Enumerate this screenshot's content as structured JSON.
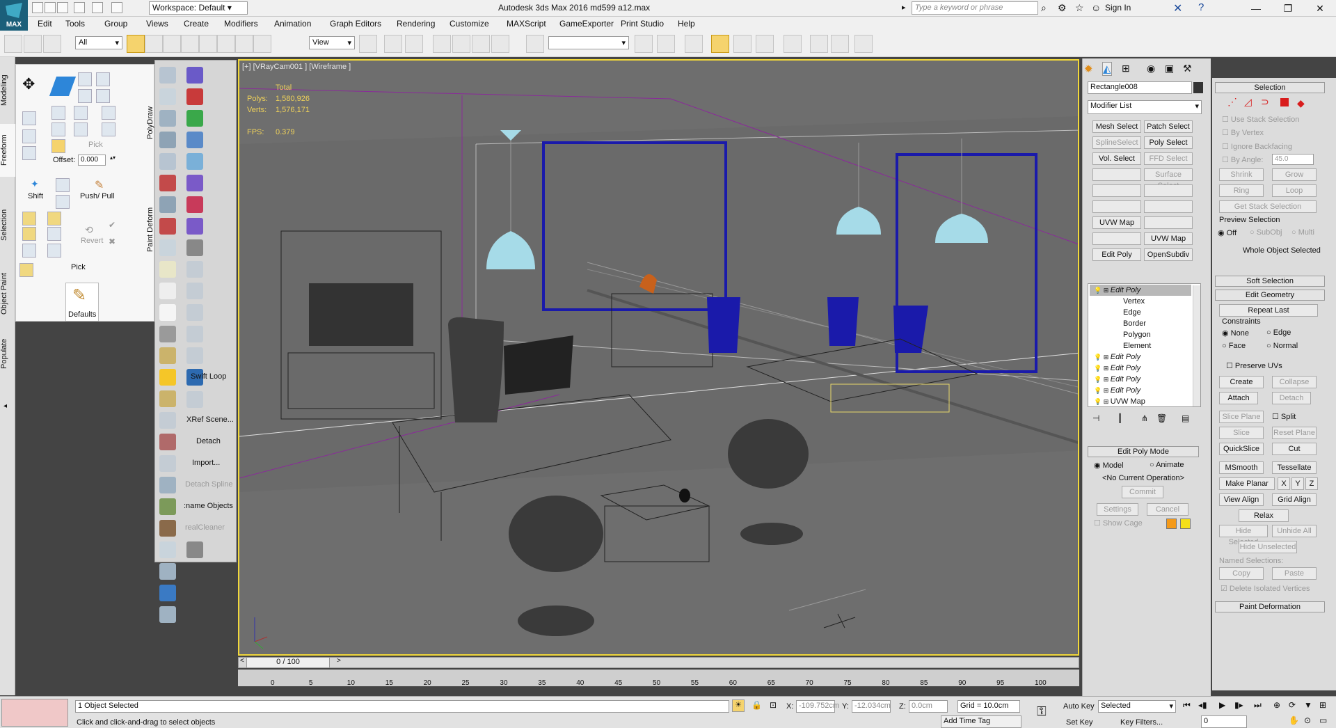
{
  "app": {
    "title": "Autodesk 3ds Max 2016     md599 a12.max",
    "logo_text": "MAX",
    "workspace": "Workspace: Default",
    "search_placeholder": "Type a keyword or phrase",
    "sign_in": "Sign In"
  },
  "menu": [
    "Edit",
    "Tools",
    "Group",
    "Views",
    "Create",
    "Modifiers",
    "Animation",
    "Graph Editors",
    "Rendering",
    "Customize",
    "MAXScript",
    "GameExporter",
    "Print Studio",
    "Help"
  ],
  "toolbar": {
    "selection_filter": "All",
    "ref_coord": "View"
  },
  "ribbon": {
    "tabs": [
      "Modeling",
      "Freeform",
      "Selection",
      "Object Paint",
      "Populate"
    ],
    "polydraw_label": "PolyDraw",
    "paint_deform_label": "Paint Deform",
    "pick_label": "Pick",
    "offset_label": "Offset:",
    "offset_value": "0.000",
    "shift_label": "Shift",
    "push_pull_label": "Push/ Pull",
    "revert_label": "Revert",
    "pick2_label": "Pick",
    "defaults_label": "Defaults"
  },
  "script_buttons": {
    "swift_loop": "Swift Loop",
    "xref_scene": "XRef Scene...",
    "detach": "Detach",
    "import": "Import...",
    "detach_spline": "Detach Spline",
    "name_objects": ":name Objects",
    "real_cleaner": "realCleaner"
  },
  "viewport": {
    "label": "[+] [VRayCam001 ] [Wireframe ]",
    "stats_header": "Total",
    "polys_label": "Polys:",
    "polys_value": "1,580,926",
    "verts_label": "Verts:",
    "verts_value": "1,576,171",
    "fps_label": "FPS:",
    "fps_value": "0.379"
  },
  "command_panel": {
    "object_name": "Rectangle008",
    "modifier_list": "Modifier List",
    "modifier_buttons": [
      [
        "Mesh Select",
        "Patch Select"
      ],
      [
        "SplineSelect",
        "Poly Select"
      ],
      [
        "Vol. Select",
        "FFD Select"
      ],
      [
        "",
        "Surface Select"
      ],
      [
        "",
        ""
      ],
      [
        "",
        ""
      ],
      [
        "UVW Map",
        ""
      ],
      [
        "",
        "UVW Map"
      ],
      [
        "Edit Poly",
        "OpenSubdiv"
      ]
    ],
    "stack": [
      {
        "name": "Edit Poly",
        "level": 0,
        "selected": true
      },
      {
        "name": "Vertex",
        "level": 1
      },
      {
        "name": "Edge",
        "level": 1
      },
      {
        "name": "Border",
        "level": 1
      },
      {
        "name": "Polygon",
        "level": 1
      },
      {
        "name": "Element",
        "level": 1
      },
      {
        "name": "Edit Poly",
        "level": 0
      },
      {
        "name": "Edit Poly",
        "level": 0
      },
      {
        "name": "Edit Poly",
        "level": 0
      },
      {
        "name": "Edit Poly",
        "level": 0
      },
      {
        "name": "UVW Map",
        "level": 0
      }
    ],
    "edit_poly_mode": "Edit Poly Mode",
    "model_label": "Model",
    "animate_label": "Animate",
    "no_operation": "<No Current Operation>",
    "commit": "Commit",
    "settings": "Settings",
    "cancel": "Cancel",
    "show_cage": "Show Cage"
  },
  "selection_rollout": {
    "title": "Selection",
    "use_stack": "Use Stack Selection",
    "by_vertex": "By Vertex",
    "ignore_backfacing": "Ignore Backfacing",
    "by_angle": "By Angle:",
    "by_angle_value": "45.0",
    "shrink": "Shrink",
    "grow": "Grow",
    "ring": "Ring",
    "loop": "Loop",
    "get_stack": "Get Stack Selection",
    "preview_selection": "Preview Selection",
    "off": "Off",
    "subobj": "SubObj",
    "multi": "Multi",
    "whole_object": "Whole Object Selected",
    "soft_selection": "Soft Selection",
    "edit_geometry": "Edit Geometry",
    "repeat_last": "Repeat Last",
    "constraints": "Constraints",
    "none": "None",
    "edge": "Edge",
    "face": "Face",
    "normal": "Normal",
    "preserve_uvs": "Preserve UVs",
    "create": "Create",
    "collapse": "Collapse",
    "attach": "Attach",
    "detach": "Detach",
    "slice_plane": "Slice Plane",
    "split": "Split",
    "slice": "Slice",
    "reset_plane": "Reset Plane",
    "quickslice": "QuickSlice",
    "cut": "Cut",
    "msmooth": "MSmooth",
    "tessellate": "Tessellate",
    "make_planar": "Make Planar",
    "x": "X",
    "y": "Y",
    "z": "Z",
    "view_align": "View Align",
    "grid_align": "Grid Align",
    "relax": "Relax",
    "hide_selected": "Hide Selected",
    "unhide_all": "Unhide All",
    "hide_unselected": "Hide Unselected",
    "named_selections": "Named Selections:",
    "copy": "Copy",
    "paste": "Paste",
    "delete_isolated": "Delete Isolated Vertices",
    "paint_deformation": "Paint Deformation"
  },
  "timeline": {
    "frame": "0 / 100",
    "ticks": [
      "0",
      "5",
      "10",
      "15",
      "20",
      "25",
      "30",
      "35",
      "40",
      "45",
      "50",
      "55",
      "60",
      "65",
      "70",
      "75",
      "80",
      "85",
      "90",
      "95",
      "100"
    ]
  },
  "status": {
    "selected_count": "1 Object Selected",
    "prompt": "Click and click-and-drag to select objects",
    "x_label": "X:",
    "x_value": "-109.752cm",
    "y_label": "Y:",
    "y_value": "-12.034cm",
    "z_label": "Z:",
    "z_value": "0.0cm",
    "grid": "Grid = 10.0cm",
    "add_time_tag": "Add Time Tag",
    "auto_key": "Auto Key",
    "set_key": "Set Key",
    "key_mode": "Selected",
    "key_filters": "Key Filters...",
    "current_frame": "0"
  },
  "colors": {
    "viewport_border": "#f2d83a",
    "viewport_bg": "#6e6e6e",
    "selected_wire": "#1a1aaa",
    "lamp": "#a6dbe8",
    "stats": "#f0d25a"
  }
}
